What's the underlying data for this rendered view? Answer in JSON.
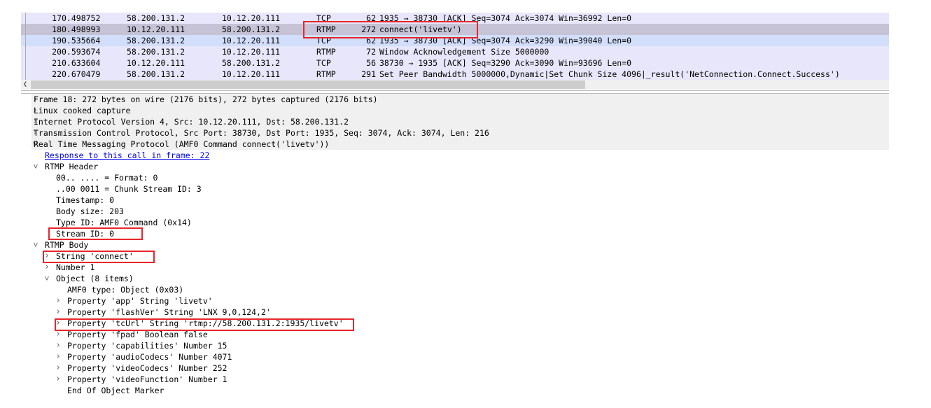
{
  "packet_list": {
    "rows": [
      {
        "no": "17",
        "time": "0.498752",
        "src": "58.200.131.2",
        "dst": "10.12.20.111",
        "proto": "TCP",
        "len": "62",
        "info": "1935 → 38730 [ACK] Seq=3074 Ack=3074 Win=36992 Len=0",
        "state": "normal"
      },
      {
        "no": "18",
        "time": "0.498993",
        "src": "10.12.20.111",
        "dst": "58.200.131.2",
        "proto": "RTMP",
        "len": "272",
        "info": "connect('livetv')",
        "state": "selected"
      },
      {
        "no": "19",
        "time": "0.535664",
        "src": "58.200.131.2",
        "dst": "10.12.20.111",
        "proto": "TCP",
        "len": "62",
        "info": "1935 → 38730 [ACK] Seq=3074 Ack=3290 Win=39040 Len=0",
        "state": "related"
      },
      {
        "no": "20",
        "time": "0.593674",
        "src": "58.200.131.2",
        "dst": "10.12.20.111",
        "proto": "RTMP",
        "len": "72",
        "info": "Window Acknowledgement Size 5000000",
        "state": "normal"
      },
      {
        "no": "21",
        "time": "0.633604",
        "src": "10.12.20.111",
        "dst": "58.200.131.2",
        "proto": "TCP",
        "len": "56",
        "info": "38730 → 1935 [ACK] Seq=3290 Ack=3090 Win=93696 Len=0",
        "state": "normal"
      },
      {
        "no": "22",
        "time": "0.670479",
        "src": "58.200.131.2",
        "dst": "10.12.20.111",
        "proto": "RTMP",
        "len": "291",
        "info": "Set Peer Bandwidth 5000000,Dynamic|Set Chunk Size 4096|_result('NetConnection.Connect.Success')",
        "state": "normal"
      }
    ],
    "scroll_left_icon": "chevron-left-icon"
  },
  "details": [
    {
      "level": 0,
      "arrow": "collapsed",
      "text": "Frame 18: 272 bytes on wire (2176 bits), 272 bytes captured (2176 bits)"
    },
    {
      "level": 0,
      "arrow": "collapsed",
      "text": "Linux cooked capture"
    },
    {
      "level": 0,
      "arrow": "collapsed",
      "text": "Internet Protocol Version 4, Src: 10.12.20.111, Dst: 58.200.131.2"
    },
    {
      "level": 0,
      "arrow": "collapsed",
      "text": "Transmission Control Protocol, Src Port: 38730, Dst Port: 1935, Seq: 3074, Ack: 3074, Len: 216"
    },
    {
      "level": 0,
      "arrow": "expanded",
      "text": "Real Time Messaging Protocol (AMF0 Command connect('livetv'))"
    },
    {
      "level": 1,
      "arrow": "none",
      "text": "Response to this call in frame: 22",
      "link": true
    },
    {
      "level": 1,
      "arrow": "expanded",
      "text": "RTMP Header"
    },
    {
      "level": 2,
      "arrow": "none",
      "text": "00.. .... = Format: 0"
    },
    {
      "level": 2,
      "arrow": "none",
      "text": "..00 0011 = Chunk Stream ID: 3"
    },
    {
      "level": 2,
      "arrow": "none",
      "text": "Timestamp: 0"
    },
    {
      "level": 2,
      "arrow": "none",
      "text": "Body size: 203"
    },
    {
      "level": 2,
      "arrow": "none",
      "text": "Type ID: AMF0 Command (0x14)"
    },
    {
      "level": 2,
      "arrow": "none",
      "text": "Stream ID: 0"
    },
    {
      "level": 1,
      "arrow": "expanded",
      "text": "RTMP Body"
    },
    {
      "level": 2,
      "arrow": "collapsed",
      "text": "String 'connect'"
    },
    {
      "level": 2,
      "arrow": "collapsed",
      "text": "Number 1"
    },
    {
      "level": 2,
      "arrow": "expanded",
      "text": "Object (8 items)"
    },
    {
      "level": 3,
      "arrow": "none",
      "text": "AMF0 type: Object (0x03)"
    },
    {
      "level": 3,
      "arrow": "collapsed",
      "text": "Property 'app' String 'livetv'"
    },
    {
      "level": 3,
      "arrow": "collapsed",
      "text": "Property 'flashVer' String 'LNX 9,0,124,2'"
    },
    {
      "level": 3,
      "arrow": "collapsed",
      "text": "Property 'tcUrl' String 'rtmp://58.200.131.2:1935/livetv'"
    },
    {
      "level": 3,
      "arrow": "collapsed",
      "text": "Property 'fpad' Boolean false"
    },
    {
      "level": 3,
      "arrow": "collapsed",
      "text": "Property 'capabilities' Number 15"
    },
    {
      "level": 3,
      "arrow": "collapsed",
      "text": "Property 'audioCodecs' Number 4071"
    },
    {
      "level": 3,
      "arrow": "collapsed",
      "text": "Property 'videoCodecs' Number 252"
    },
    {
      "level": 3,
      "arrow": "collapsed",
      "text": "Property 'videoFunction' Number 1"
    },
    {
      "level": 3,
      "arrow": "none",
      "text": "End Of Object Marker"
    }
  ],
  "colors": {
    "annotation": "#e8262b",
    "selected_row": "#c6c3d6",
    "row": "#e7e6fa",
    "related_row": "#d2defa",
    "link": "#0000ee"
  }
}
